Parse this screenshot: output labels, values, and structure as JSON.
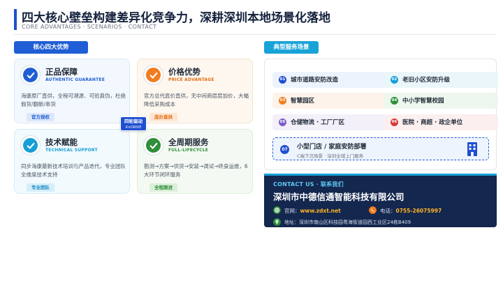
{
  "header": {
    "title": "四大核心壁垒构建差异化竞争力，深耕深圳本地场景化落地",
    "subtitle": "CORE ADVANTAGES · SCENARIOS · CONTACT"
  },
  "left": {
    "tag": "核心四大优势",
    "cards": [
      {
        "title": "正品保障",
        "en": "AUTHENTIC GUARANTEE",
        "desc": "海康原厂直供，全程可溯源、可验真伪，杜绝假货/翻新/串货",
        "badge": "官方授权",
        "icon": "check-badge-icon",
        "color": "#1f5ed4"
      },
      {
        "title": "价格优势",
        "en": "PRICE ADVANTAGE",
        "desc": "官方总代底价直供，无中间商层层加价，大幅降低采购成本",
        "badge": "底价直供",
        "icon": "check-badge-icon",
        "color": "#f07d1f"
      },
      {
        "title": "技术赋能",
        "en": "TECHNICAL SUPPORT",
        "desc": "同步海康最新技术培训与产品迭代，专业团队全维度技术支持",
        "badge": "专业团队",
        "icon": "check-badge-icon",
        "color": "#169fd6"
      },
      {
        "title": "全周期服务",
        "en": "FULL-LIFECYCLE",
        "desc": "勘测→方案→供货→安装→调试→终身运维，6大环节闭环服务",
        "badge": "全程跟进",
        "icon": "check-badge-icon",
        "color": "#2f8f3a"
      }
    ],
    "center_badge": {
      "line1": "四轮驱动",
      "line2": "4×DRIVE"
    }
  },
  "right": {
    "tag": "典型服务场景",
    "scenarios": [
      {
        "num": "01",
        "label": "城市道路安防改造"
      },
      {
        "num": "02",
        "label": "老旧小区安防升级"
      },
      {
        "num": "03",
        "label": "智慧园区"
      },
      {
        "num": "04",
        "label": "中小学智慧校园"
      },
      {
        "num": "05",
        "label": "仓储物流 · 工厂厂区"
      },
      {
        "num": "06",
        "label": "医院 · 商超 · 政企单位"
      }
    ],
    "wide": {
      "num": "07",
      "label": "小型门店 / 家庭安防部署",
      "sub": "C端下沉场景 · 深圳全域上门服务",
      "icon": "building-icon"
    },
    "contact": {
      "heading": "CONTACT US · 联系我们",
      "company": "深圳市中德信通智能科技有限公司",
      "website_label": "官网：",
      "website": "www.zdxt.net",
      "phone_label": "电话：",
      "phone": "0755-26075997",
      "address": "地址：深圳市南山区科技园粤海街道园西工业区24栋B409",
      "colors": {
        "globe": "#2f8f3a",
        "phone": "#f07d1f",
        "pin": "#2f8f3a"
      }
    }
  }
}
